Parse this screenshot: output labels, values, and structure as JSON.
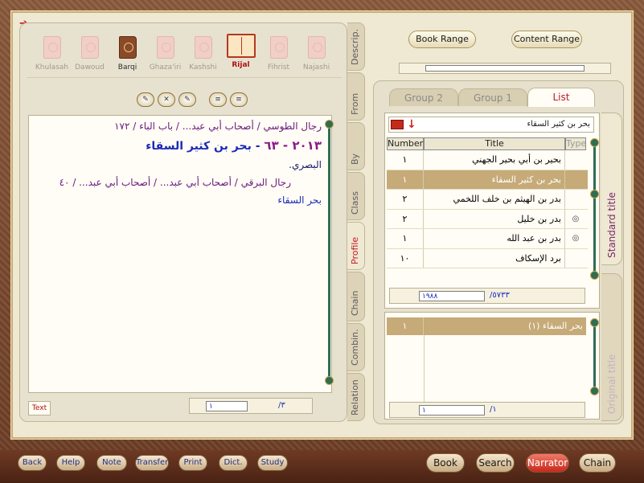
{
  "books": [
    {
      "label": "Khulasah",
      "style": "faded"
    },
    {
      "label": "Dawoud",
      "style": "faded"
    },
    {
      "label": "Barqi",
      "style": "brown"
    },
    {
      "label": "Ghaza'iri",
      "style": "faded"
    },
    {
      "label": "Kashshi",
      "style": "faded"
    },
    {
      "label": "Rijal",
      "style": "open"
    },
    {
      "label": "Fihrist",
      "style": "faded"
    },
    {
      "label": "Najashi",
      "style": "faded"
    }
  ],
  "vtabs": [
    "Descrip.",
    "From",
    "By",
    "Class",
    "Profile",
    "Chain",
    "Combin.",
    "Relation"
  ],
  "active_vtab": "Profile",
  "text": {
    "line1": "رجال الطوسي / أصحاب أبي عبد... / باب الباء / ١٧٢",
    "line2_num": "٢٠١٣ - ٦٣",
    "line2_text": "بحر بن كثير السقاء",
    "line3": "البصري.",
    "line4": "رجال البرقي / أصحاب أبي عبد... / أصحاب أبي عبد... / ٤٠",
    "line5": "بحر السقاء"
  },
  "text_tab": "Text",
  "text_page": {
    "current": "١",
    "total": "/٣"
  },
  "range": {
    "book_range": "Book Range",
    "content_range": "Content Range"
  },
  "htabs": {
    "group2": "Group 2",
    "group1": "Group 1",
    "list": "List"
  },
  "search": {
    "value": "بحر بن كثير السقاء"
  },
  "grid": {
    "headers": {
      "number": "Number",
      "title": "Title",
      "type": "Type"
    },
    "rows": [
      {
        "number": "١",
        "title": "بحير بن أبي بحير الجهني",
        "type": ""
      },
      {
        "number": "١",
        "title": "بحر بن كثير السقاء",
        "type": "",
        "selected": true
      },
      {
        "number": "٢",
        "title": "بدر بن الهيثم بن خلف اللخمي",
        "type": ""
      },
      {
        "number": "٢",
        "title": "بدر بن خليل",
        "type": "◎"
      },
      {
        "number": "١",
        "title": "بدر بن عبد الله",
        "type": "◎"
      },
      {
        "number": "١٠",
        "title": "برد الإسكاف",
        "type": ""
      }
    ]
  },
  "count": {
    "current": "١٩٨٨",
    "total": "/٥٧٣٣"
  },
  "result": {
    "number": "١",
    "title": "بحر السقاء (١)"
  },
  "result_page": {
    "current": "١",
    "total": "/١"
  },
  "side_tabs": {
    "standard": "Standard title",
    "original": "Original title"
  },
  "nav": [
    "Back",
    "Help",
    "Note",
    "Transfer",
    "Print",
    "Dict.",
    "Study"
  ],
  "big_nav": [
    "Book",
    "Search",
    "Narrator",
    "Chain"
  ],
  "active_big_nav": "Narrator"
}
